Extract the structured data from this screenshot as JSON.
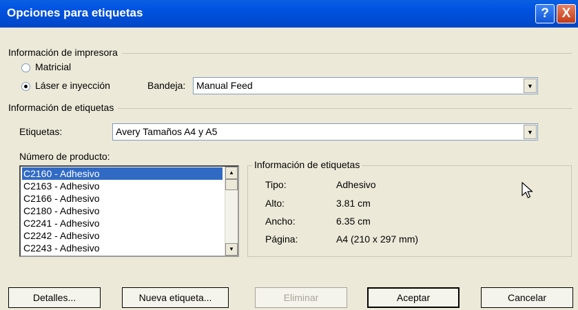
{
  "window": {
    "title": "Opciones para etiquetas",
    "help_glyph": "?",
    "close_glyph": "X"
  },
  "printer_info": {
    "label": "Información de impresora",
    "matricial_label": "Matricial",
    "laser_label": "Láser e inyección",
    "bandeja_label": "Bandeja:",
    "bandeja_value": "Manual Feed"
  },
  "label_info": {
    "label": "Información de etiquetas",
    "etiquetas_label": "Etiquetas:",
    "etiquetas_value": "Avery Tamaños A4 y A5",
    "product_number_label": "Número de producto:",
    "products": [
      "C2160 - Adhesivo",
      "C2163 - Adhesivo",
      "C2166 - Adhesivo",
      "C2180 - Adhesivo",
      "C2241 - Adhesivo",
      "C2242 - Adhesivo",
      "C2243 - Adhesivo"
    ]
  },
  "details_group": {
    "label": "Información de etiquetas",
    "rows": [
      {
        "key": "Tipo:",
        "value": "Adhesivo"
      },
      {
        "key": "Alto:",
        "value": "3.81 cm"
      },
      {
        "key": "Ancho:",
        "value": "6.35 cm"
      },
      {
        "key": "Página:",
        "value": "A4 (210 x 297 mm)"
      }
    ]
  },
  "buttons": {
    "detalles": "Detalles...",
    "nueva_etiqueta": "Nueva etiqueta...",
    "eliminar": "Eliminar",
    "aceptar": "Aceptar",
    "cancelar": "Cancelar"
  }
}
